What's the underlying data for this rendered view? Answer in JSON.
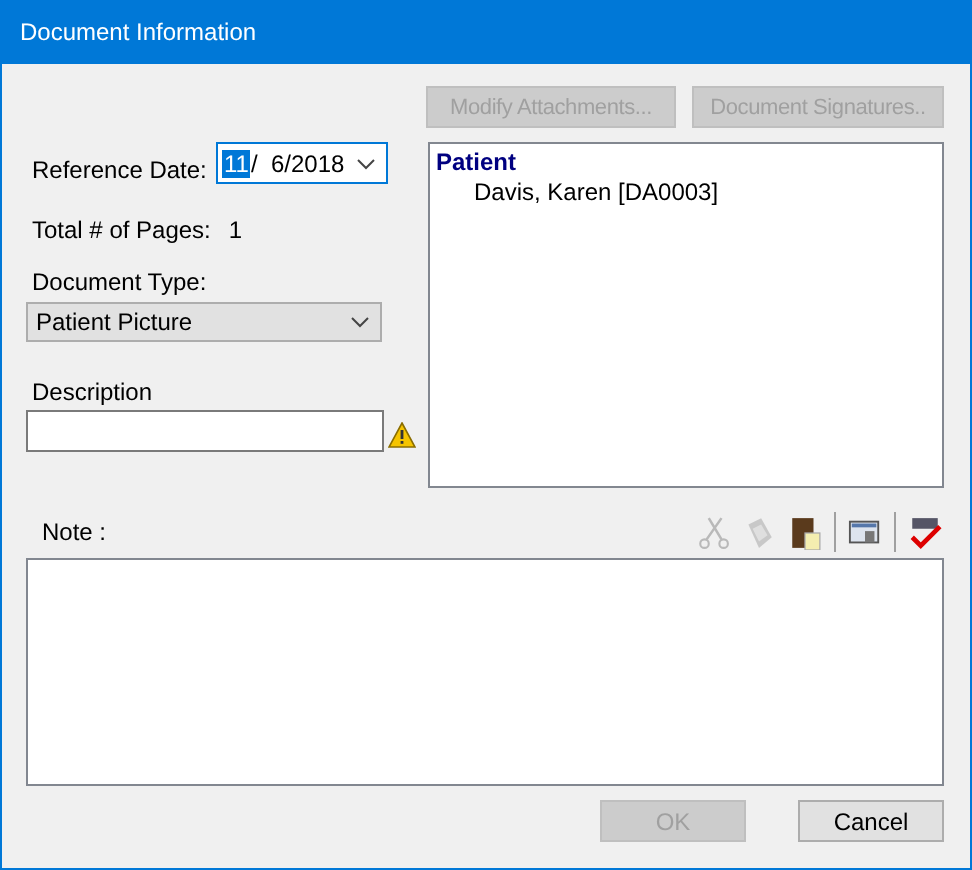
{
  "window": {
    "title": "Document Information"
  },
  "top_buttons": [
    {
      "label": "Modify Attachments...",
      "disabled": true
    },
    {
      "label": "Document Signatures..",
      "disabled": true
    }
  ],
  "reference_date": {
    "label": "Reference Date:",
    "month": "11",
    "month_selected": true,
    "rest": "/  6/2018"
  },
  "total_pages": {
    "label": "Total # of Pages:",
    "value": "1"
  },
  "document_type": {
    "label": "Document Type:",
    "value": "Patient Picture"
  },
  "description": {
    "label": "Description",
    "warning": true
  },
  "patient_list": {
    "header": "Patient",
    "items": [
      "Davis, Karen [DA0003]"
    ]
  },
  "note": {
    "label": "Note :",
    "toolbar": [
      {
        "kind": "cut",
        "disabled": true
      },
      {
        "kind": "copy",
        "disabled": true
      },
      {
        "kind": "paste",
        "disabled": false
      },
      {
        "kind": "separator"
      },
      {
        "kind": "insert",
        "disabled": false
      },
      {
        "kind": "separator"
      },
      {
        "kind": "spellcheck",
        "disabled": false
      }
    ]
  },
  "footer_buttons": [
    {
      "label": "OK",
      "disabled": true
    },
    {
      "label": "Cancel",
      "disabled": false
    }
  ]
}
